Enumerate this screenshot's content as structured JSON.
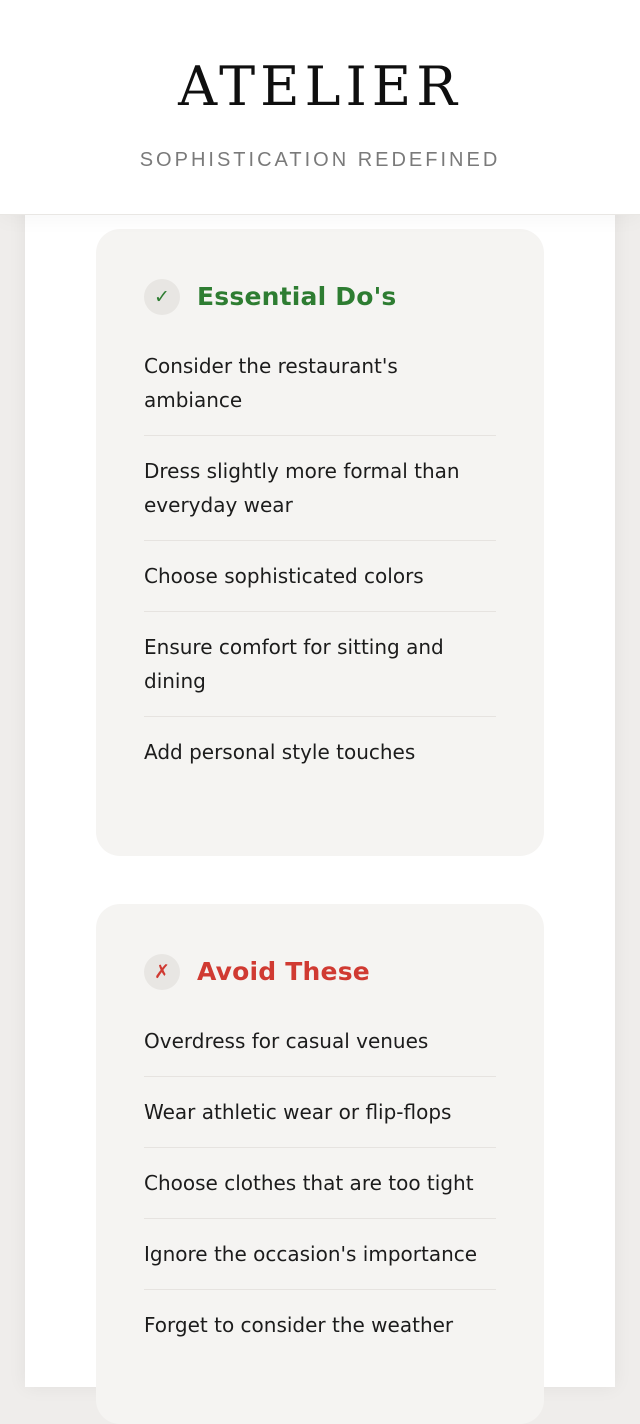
{
  "header": {
    "brand": "ATELIER",
    "tagline": "SOPHISTICATION REDEFINED"
  },
  "dos": {
    "icon": "checkmark-icon",
    "icon_glyph": "✓",
    "title": "Essential Do's",
    "color": "#2e7d32",
    "items": [
      "Consider the restaurant's ambiance",
      "Dress slightly more formal than everyday wear",
      "Choose sophisticated colors",
      "Ensure comfort for sitting and dining",
      "Add personal style touches"
    ]
  },
  "donts": {
    "icon": "cross-icon",
    "icon_glyph": "✗",
    "title": "Avoid These",
    "color": "#d03a32",
    "items": [
      "Overdress for casual venues",
      "Wear athletic wear or flip-flops",
      "Choose clothes that are too tight",
      "Ignore the occasion's importance",
      "Forget to consider the weather"
    ]
  }
}
